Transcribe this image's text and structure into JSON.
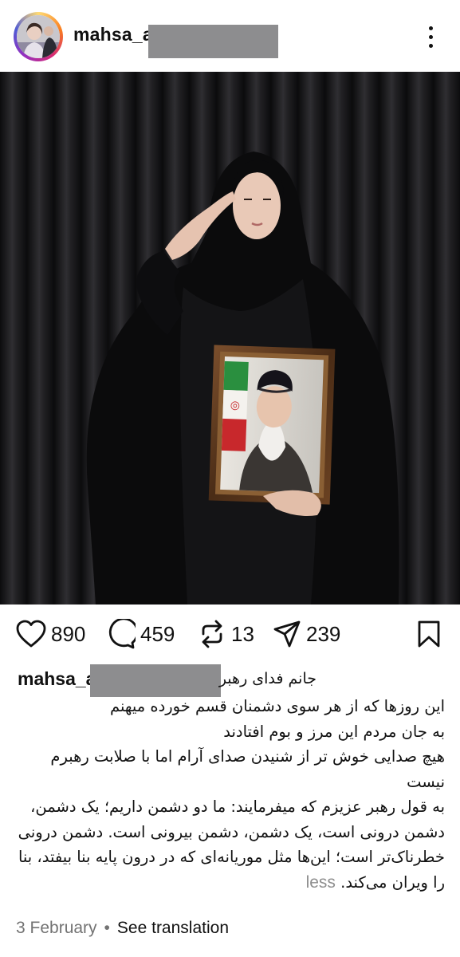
{
  "post": {
    "username": "mahsa_a",
    "caption_first_line": "جانم فدای رهبر",
    "caption_lines": [
      "این روزها که از هر سوی دشمنان قسم خورده میهنم",
      "به جان مردم این مرز و بوم افتادند",
      "هیچ صدایی خوش تر از شنیدن صدای آرام اما با صلابت رهبرم نیست",
      "به قول رهبر عزیزم که میفرمایند: ما دو دشمن داریم؛ یک دشمن، دشمن درونی است، یک دشمن، دشمن بیرونی است. دشمن درونی خطرناک‌تر است؛ این‌ها مثل موریانه‌ای که در درون پایه بنا بیفتد، بنا را ویران می‌کند."
    ],
    "less_label": "less",
    "date": "3 February",
    "separator": "•",
    "translate_label": "See translation"
  },
  "actions": {
    "likes": "890",
    "comments": "459",
    "reposts": "13",
    "shares": "239"
  },
  "icons": {
    "more": "more-options-icon",
    "like": "heart-icon",
    "comment": "comment-icon",
    "repost": "repost-icon",
    "share": "send-icon",
    "save": "bookmark-icon"
  },
  "colors": {
    "text": "#111111",
    "muted": "#737373",
    "redaction": "#8d8d8f",
    "background": "#ffffff"
  }
}
